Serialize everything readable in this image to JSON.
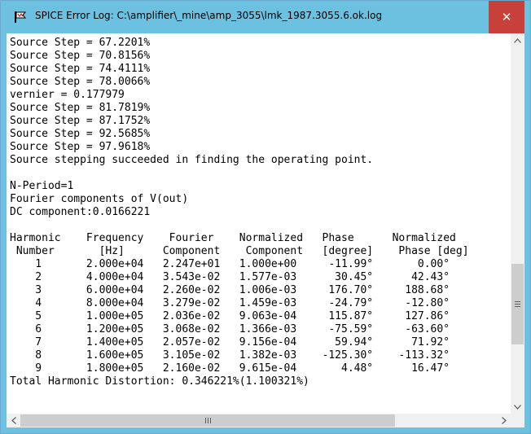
{
  "window": {
    "title": "SPICE Error Log: C:\\amplifier\\_mine\\amp_3055\\lmk_1987.3055.6.ok.log",
    "close_glyph": "✕",
    "accent_color": "#6cc0e0",
    "close_color": "#c7403a"
  },
  "log": {
    "lines": [
      "Source Step = 67.2201%",
      "Source Step = 70.8156%",
      "Source Step = 74.4111%",
      "Source Step = 78.0066%",
      "vernier = 0.177979",
      "Source Step = 81.7819%",
      "Source Step = 87.1752%",
      "Source Step = 92.5685%",
      "Source Step = 97.9618%",
      "Source stepping succeeded in finding the operating point.",
      "",
      "N-Period=1",
      "Fourier components of V(out)",
      "DC component:0.0166221",
      "",
      "Harmonic    Frequency    Fourier    Normalized   Phase      Normalized",
      " Number       [Hz]      Component    Component   [degree]    Phase [deg]",
      "    1       2.000e+04   2.247e+01   1.000e+00     -11.99°       0.00°",
      "    2       4.000e+04   3.543e-02   1.577e-03      30.45°      42.43°",
      "    3       6.000e+04   2.260e-02   1.006e-03     176.70°     188.68°",
      "    4       8.000e+04   3.279e-02   1.459e-03     -24.79°     -12.80°",
      "    5       1.000e+05   2.036e-02   9.063e-04     115.87°     127.86°",
      "    6       1.200e+05   3.068e-02   1.366e-03     -75.59°     -63.60°",
      "    7       1.400e+05   2.057e-02   9.156e-04      59.94°      71.92°",
      "    8       1.600e+05   3.105e-02   1.382e-03    -125.30°    -113.32°",
      "    9       1.800e+05   2.160e-02   9.615e-04       4.48°      16.47°",
      "Total Harmonic Distortion: 0.346221%(1.100321%)"
    ]
  }
}
